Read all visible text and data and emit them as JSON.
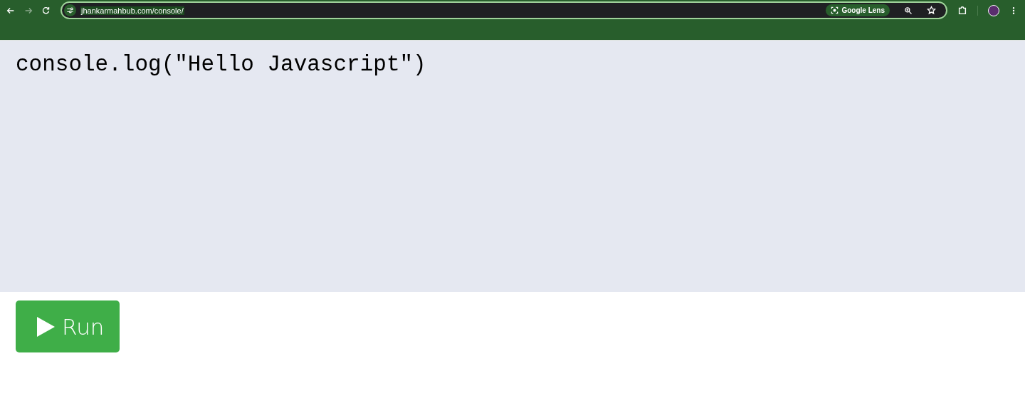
{
  "browser": {
    "url": "jhankarmahbub.com/console/",
    "lens_label": "Google Lens"
  },
  "editor": {
    "code": "console.log(\"Hello Javascript\")"
  },
  "run_button": {
    "label": "Run"
  }
}
